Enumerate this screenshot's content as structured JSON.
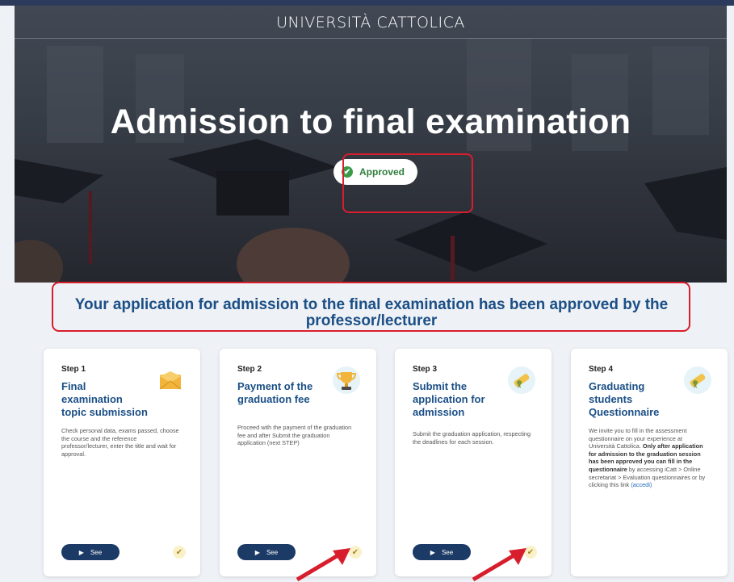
{
  "header": {
    "brand": "UNIVERSITÀ CATTOLICA",
    "title": "Admission to final examination",
    "status_label": "Approved"
  },
  "message": {
    "text": "Your application for admission to the final examination has been approved by the professor/lecturer"
  },
  "steps": [
    {
      "step": "Step 1",
      "title": "Final examination topic submission",
      "description": "Check personal data, exams passed, choose the course and the reference professor/lecturer, enter the title and wait for approval.",
      "button": "See",
      "icon": "envelope-icon"
    },
    {
      "step": "Step 2",
      "title": "Payment of the graduation fee",
      "description": "Proceed with the payment of the graduation fee and after Submit the graduation application (next STEP)",
      "button": "See",
      "icon": "trophy-icon"
    },
    {
      "step": "Step 3",
      "title": "Submit the application for admission",
      "description": "Submit the graduation application, respecting the deadlines for each session.",
      "button": "See",
      "icon": "diploma-icon"
    },
    {
      "step": "Step 4",
      "title": "Graduating students Questionnaire",
      "description_start": "We invite you to fill in the assessment questionnaire on your experience at Università Cattolica.",
      "description_bold": "Only after application for admission to the graduation session has been approved you can fill in the questionnaire",
      "description_end": "by accessing iCatt > Online secretariat > Evaluation questionnaires or by clicking this link",
      "link": "(accedi)",
      "icon": "diploma-icon"
    }
  ],
  "colors": {
    "accent_blue": "#1b4f86",
    "button_navy": "#1b3a66",
    "highlight_red": "#d81e2c",
    "approved_green": "#3a9a4a"
  }
}
